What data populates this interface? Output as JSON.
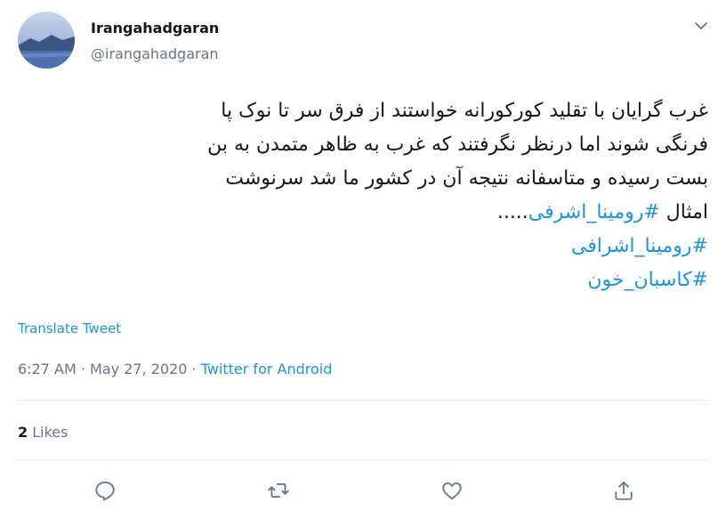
{
  "user": {
    "display_name": "Irangahadgaran",
    "handle": "@irangahadgaran"
  },
  "tweet": {
    "lines": [
      "غرب گرایان با تقلید کورکورانه خواستند از فرق سر تا نوک پا",
      "فرنگی شوند اما درنظر نگرفتند که غرب به ظاهر متمدن به بن",
      "بست رسیده و متاسفانه نتیجه آن در کشور ما شد سرنوشت"
    ],
    "line4_prefix": "امثال ",
    "line4_hashtag": "#رومینا_اشرفی",
    "line4_suffix": ".....",
    "hashtag2": "#رومینا_اشرافی",
    "hashtag3": "#کاسبان_خون"
  },
  "translate_label": "Translate Tweet",
  "meta": {
    "time": "6:27 AM",
    "separator1": " · ",
    "date": "May 27, 2020",
    "separator2": " · ",
    "source": "Twitter for Android"
  },
  "likes": {
    "count": "2",
    "label": "Likes"
  },
  "actions": {
    "reply_icon": "reply-icon",
    "retweet_icon": "retweet-icon",
    "like_icon": "heart-icon",
    "share_icon": "share-icon"
  },
  "colors": {
    "link": "#1b95e0",
    "secondary": "#657786",
    "primary_text": "#14171a",
    "divider": "#e6ecf0"
  }
}
